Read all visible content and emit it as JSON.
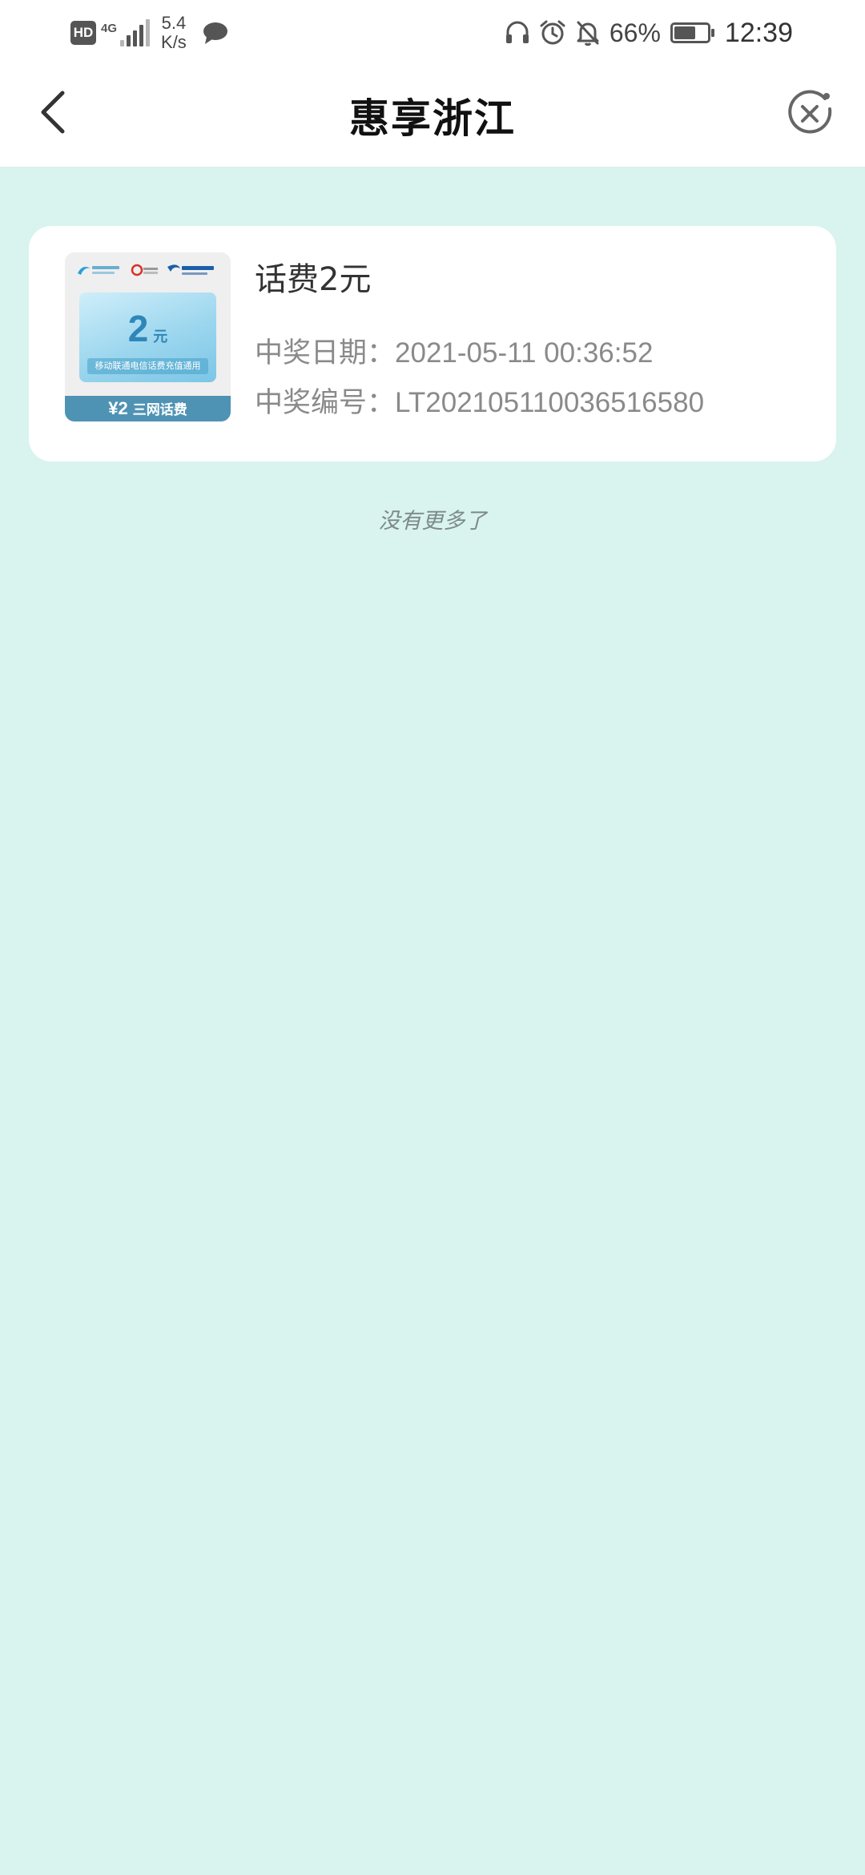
{
  "status_bar": {
    "hd_label": "HD",
    "network_label": "4G",
    "speed_value": "5.4",
    "speed_unit": "K/s",
    "battery_percent": "66%",
    "battery_level": 0.66,
    "time": "12:39",
    "icons": [
      "chat-bubble-icon",
      "headphones-icon",
      "alarm-icon",
      "bell-muted-icon",
      "battery-icon"
    ]
  },
  "nav": {
    "title": "惠享浙江",
    "back_icon": "chevron-left-icon",
    "close_icon": "close-circle-icon"
  },
  "prize": {
    "image": {
      "carriers": [
        "中国移动",
        "中国联通",
        "中国电信"
      ],
      "amount": "2",
      "unit": "元",
      "caption": "移动联通电信话费充值通用",
      "strip_value": "¥2",
      "strip_text": "三网话费"
    },
    "title": "话费2元",
    "date_label": "中奖日期：",
    "date_value": "2021-05-11 00:36:52",
    "serial_label": "中奖编号：",
    "serial_value": "LT202105110036516580"
  },
  "list_end_text": "没有更多了",
  "colors": {
    "page_background": "#d9f3ef",
    "card_background": "#ffffff",
    "strip_blue": "#4f93b4",
    "muted_text": "#8a8a8a"
  }
}
